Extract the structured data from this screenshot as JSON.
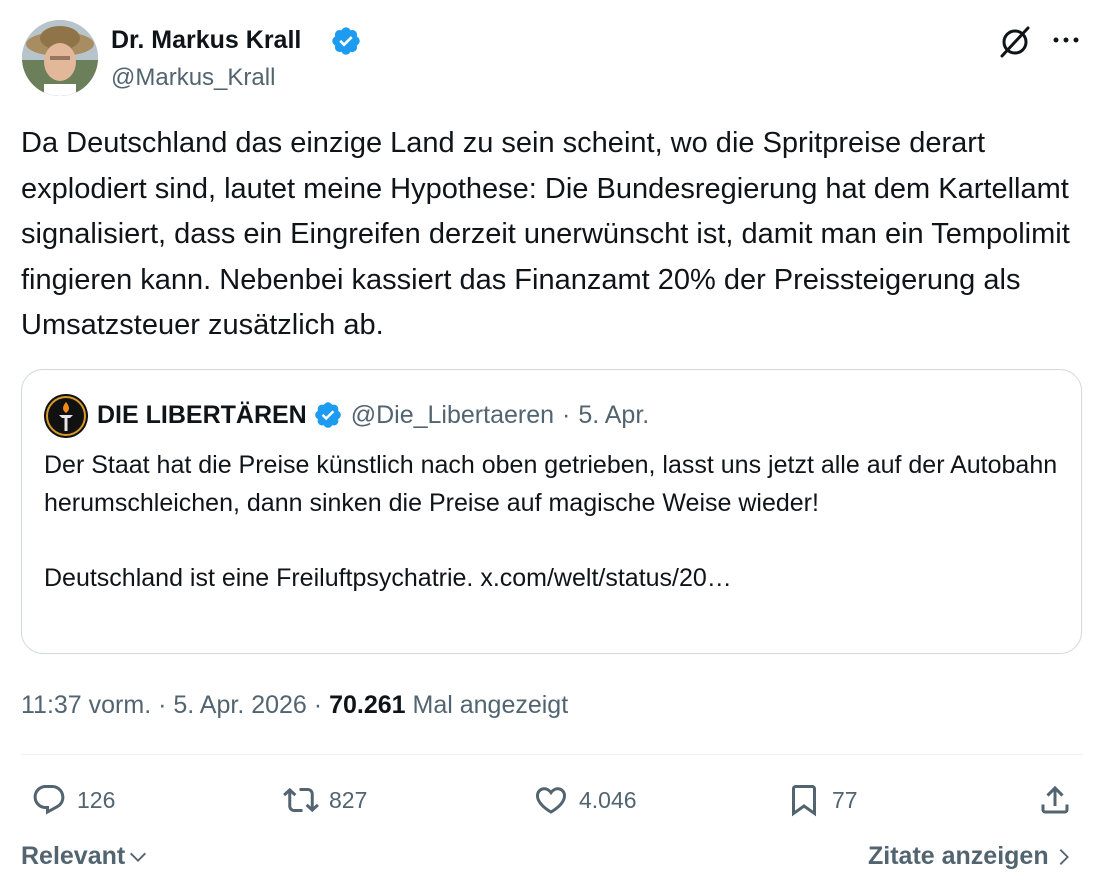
{
  "author": {
    "display_name": "Dr. Markus Krall",
    "handle": "@Markus_Krall",
    "verified_icon": "verified-badge-icon"
  },
  "tweet": {
    "text": "Da Deutschland das einzige Land zu sein scheint, wo die Spritpreise derart explodiert sind, lautet meine Hypothese: Die Bundesregierung hat dem Kartellamt signalisiert, dass ein Eingreifen derzeit unerwünscht ist, damit man ein Tempolimit fingieren kann. Nebenbei kassiert das Finanzamt 20% der Preissteigerung als Umsatzsteuer zusätzlich ab."
  },
  "quote": {
    "display_name": "DIE LIBERTÄREN",
    "handle": "@Die_Libertaeren",
    "separator": "·",
    "date": "5. Apr.",
    "paragraph1": "Der Staat hat die Preise künstlich nach oben getrieben, lasst uns jetzt alle auf der Autobahn herumschleichen, dann sinken die Preise auf magische Weise wieder!",
    "paragraph2": "Deutschland ist eine Freiluftpsychatrie. x.com/welt/status/20…"
  },
  "meta": {
    "time": "11:37 vorm.",
    "sep1": "·",
    "date": "5. Apr. 2026",
    "sep2": "·",
    "views_count": "70.261",
    "views_label": "Mal angezeigt"
  },
  "actions": {
    "replies": "126",
    "retweets": "827",
    "likes": "4.046",
    "bookmarks": "77"
  },
  "footer": {
    "sort_label": "Relevant",
    "quotes_label": "Zitate anzeigen"
  },
  "colors": {
    "text": "#0f1419",
    "secondary": "#536471",
    "verified": "#1d9bf0",
    "border": "#cfd9de"
  }
}
